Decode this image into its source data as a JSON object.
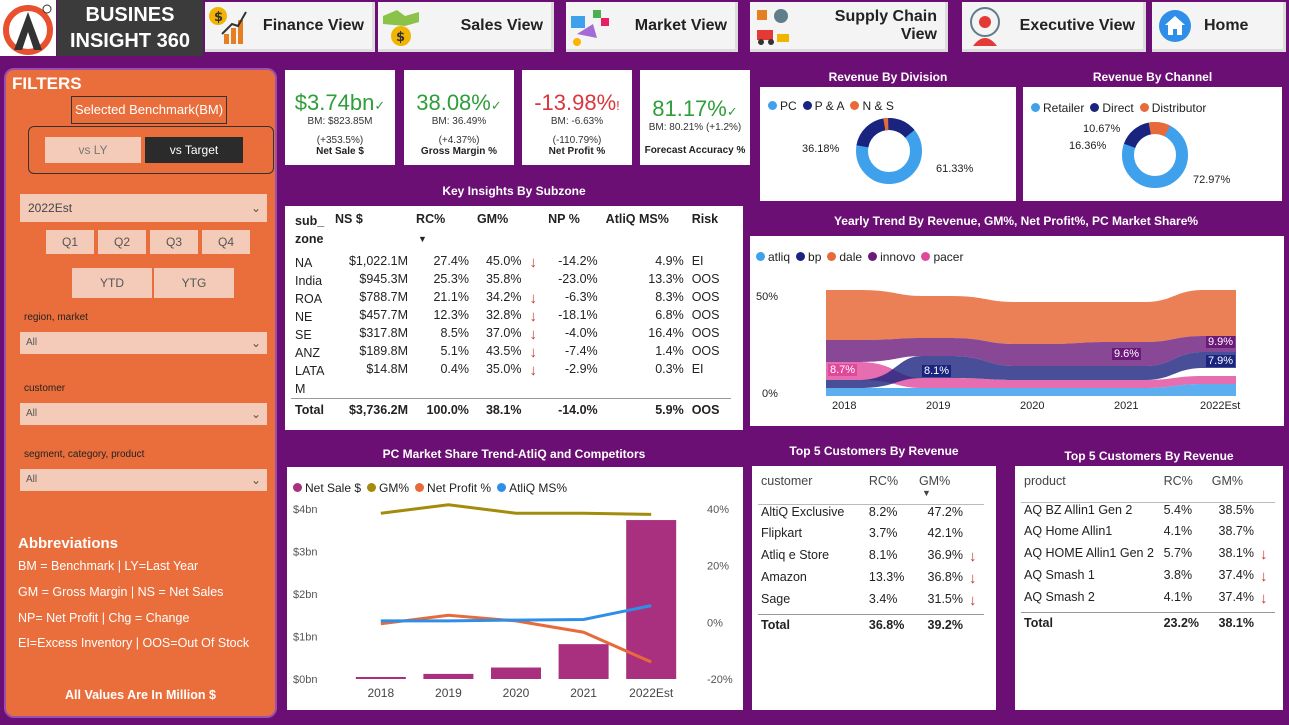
{
  "nav": {
    "brand_line1": "BUSINES",
    "brand_line2": "INSIGHT 360",
    "items": [
      {
        "label": "Finance View",
        "icon": "finance-chart-icon"
      },
      {
        "label": "Sales View",
        "icon": "handshake-coin-icon"
      },
      {
        "label": "Market View",
        "icon": "marketing-icon"
      },
      {
        "label": "Supply Chain View",
        "icon": "supply-chain-icon"
      },
      {
        "label": "Executive View",
        "icon": "executive-icon"
      },
      {
        "label": "Home",
        "icon": "home-icon"
      }
    ]
  },
  "filters": {
    "title": "FILTERS",
    "benchmark_label": "Selected Benchmark(BM)",
    "toggle": [
      "vs LY",
      "vs Target"
    ],
    "year": "2022Est",
    "quarters": [
      "Q1",
      "Q2",
      "Q3",
      "Q4"
    ],
    "ytd": "YTD",
    "ytg": "YTG",
    "dropdowns": [
      {
        "label": "region, market",
        "value": "All"
      },
      {
        "label": "customer",
        "value": "All"
      },
      {
        "label": "segment, category, product",
        "value": "All"
      }
    ],
    "abbr_title": "Abbreviations",
    "abbr_lines": [
      "BM = Benchmark | LY=Last Year",
      "GM = Gross Margin | NS = Net Sales",
      "NP= Net Profit | Chg = Change",
      "EI=Excess Inventory | OOS=Out Of Stock"
    ],
    "footnote": "All Values Are In Million $"
  },
  "kpis": [
    {
      "value": "$3.74bn",
      "mark": "✓",
      "bm": "BM: $823.85M",
      "chg": "(+353.5%)",
      "name": "Net Sale $",
      "color": "#2e9e3a"
    },
    {
      "value": "38.08%",
      "mark": "✓",
      "bm": "BM: 36.49%",
      "chg": "(+4.37%)",
      "name": "Gross Margin %",
      "color": "#2e9e3a"
    },
    {
      "value": "-13.98%",
      "mark": "!",
      "bm": "BM: -6.63%",
      "chg": "(-110.79%)",
      "name": "Net Profit %",
      "color": "#d9363e"
    },
    {
      "value": "81.17%",
      "mark": "✓",
      "bm": "BM: 80.21% (+1.2%)",
      "chg": "",
      "name": "Forecast Accuracy %",
      "color": "#2e9e3a"
    }
  ],
  "revenue_division": {
    "title": "Revenue By Division",
    "legend": [
      "PC",
      "P & A",
      "N & S"
    ],
    "labels": [
      "36.18%",
      "61.33%"
    ],
    "colors": [
      "#3fa0ec",
      "#1a237e",
      "#e86a3a"
    ]
  },
  "revenue_channel": {
    "title": "Revenue By Channel",
    "legend": [
      "Retailer",
      "Direct",
      "Distributor"
    ],
    "labels": [
      "10.67%",
      "16.36%",
      "72.97%"
    ],
    "colors": [
      "#3fa0ec",
      "#1a237e",
      "#e86a3a"
    ]
  },
  "subzone": {
    "title": "Key Insights By Subzone",
    "headers": [
      "sub_ zone",
      "NS $",
      "RC%",
      "GM%",
      "",
      "NP %",
      "AtliQ MS%",
      "Risk"
    ],
    "rows": [
      [
        "NA",
        "$1,022.1M",
        "27.4%",
        "45.0%",
        "down",
        "-14.2%",
        "4.9%",
        "EI"
      ],
      [
        "India",
        "$945.3M",
        "25.3%",
        "35.8%",
        "",
        "-23.0%",
        "13.3%",
        "OOS"
      ],
      [
        "ROA",
        "$788.7M",
        "21.1%",
        "34.2%",
        "down",
        "-6.3%",
        "8.3%",
        "OOS"
      ],
      [
        "NE",
        "$457.7M",
        "12.3%",
        "32.8%",
        "down",
        "-18.1%",
        "6.8%",
        "OOS"
      ],
      [
        "SE",
        "$317.8M",
        "8.5%",
        "37.0%",
        "down",
        "-4.0%",
        "16.4%",
        "OOS"
      ],
      [
        "ANZ",
        "$189.8M",
        "5.1%",
        "43.5%",
        "down",
        "-7.4%",
        "1.4%",
        "OOS"
      ],
      [
        "LATA M",
        "$14.8M",
        "0.4%",
        "35.0%",
        "down",
        "-2.9%",
        "0.3%",
        "EI"
      ]
    ],
    "total": [
      "Total",
      "$3,736.2M",
      "100.0%",
      "38.1%",
      "",
      "-14.0%",
      "5.9%",
      "OOS"
    ]
  },
  "trend": {
    "title": "Yearly Trend By Revenue, GM%, Net Profit%, PC Market Share%",
    "legend": [
      {
        "name": "atliq",
        "color": "#3fa0ec"
      },
      {
        "name": "bp",
        "color": "#1a237e"
      },
      {
        "name": "dale",
        "color": "#e86a3a"
      },
      {
        "name": "innovo",
        "color": "#6b1a7a"
      },
      {
        "name": "pacer",
        "color": "#e0489b"
      }
    ],
    "y_labels": [
      "50%",
      "0%"
    ],
    "years": [
      "2018",
      "2019",
      "2020",
      "2021",
      "2022Est"
    ],
    "data_labels": [
      "8.7%",
      "8.1%",
      "9.6%",
      "9.9%",
      "7.9%"
    ]
  },
  "chart_data": {
    "type": "bar",
    "title": "PC Market Share Trend-AtliQ and Competitors",
    "categories": [
      "2018",
      "2019",
      "2020",
      "2021",
      "2022Est"
    ],
    "left_axis": [
      "$4bn",
      "$3bn",
      "$2bn",
      "$1bn",
      "$0bn"
    ],
    "right_axis": [
      "40%",
      "20%",
      "0%",
      "-20%"
    ],
    "series": [
      {
        "name": "Net Sale $",
        "color": "#a8307e",
        "values": [
          0.02,
          0.12,
          0.27,
          0.82,
          3.74
        ]
      },
      {
        "name": "GM%",
        "color": "#a38b0c",
        "values": [
          38.5,
          41.5,
          38.5,
          38.5,
          38.1
        ]
      },
      {
        "name": "Net Profit %",
        "color": "#e8693a",
        "values": [
          -0.5,
          2.5,
          0.5,
          -3.5,
          -14.0
        ]
      },
      {
        "name": "AtliQ MS%",
        "color": "#2f8fe8",
        "values": [
          0.5,
          0.5,
          0.8,
          1.0,
          5.9
        ]
      }
    ],
    "ylim_left": [
      0,
      4
    ],
    "ylim_right": [
      -20,
      40
    ]
  },
  "top_customers": {
    "title": "Top 5 Customers By Revenue",
    "headers": [
      "customer",
      "RC%",
      "GM%"
    ],
    "rows": [
      [
        "AltiQ Exclusive",
        "8.2%",
        "47.2%",
        ""
      ],
      [
        "Flipkart",
        "3.7%",
        "42.1%",
        ""
      ],
      [
        "Atliq e Store",
        "8.1%",
        "36.9%",
        "down"
      ],
      [
        "Amazon",
        "13.3%",
        "36.8%",
        "down"
      ],
      [
        "Sage",
        "3.4%",
        "31.5%",
        "down"
      ]
    ],
    "total": [
      "Total",
      "36.8%",
      "39.2%"
    ]
  },
  "top_products": {
    "title": "Top 5 Customers By Revenue",
    "headers": [
      "product",
      "RC%",
      "GM%"
    ],
    "rows": [
      [
        "AQ BZ Allin1 Gen 2",
        "5.4%",
        "38.5%",
        ""
      ],
      [
        "AQ Home Allin1",
        "4.1%",
        "38.7%",
        ""
      ],
      [
        "AQ HOME Allin1 Gen 2",
        "5.7%",
        "38.1%",
        "down"
      ],
      [
        "AQ Smash 1",
        "3.8%",
        "37.4%",
        "down"
      ],
      [
        "AQ Smash 2",
        "4.1%",
        "37.4%",
        "down"
      ]
    ],
    "total": [
      "Total",
      "23.2%",
      "38.1%"
    ]
  }
}
